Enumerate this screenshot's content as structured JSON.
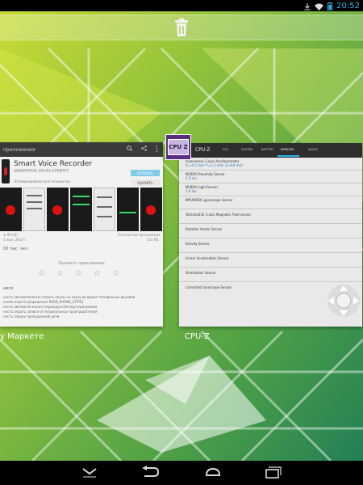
{
  "status_bar": {
    "time": "20:52"
  },
  "recents": {
    "trash_icon": "trash-icon",
    "cards": [
      {
        "caption": "у Маркете",
        "app_bar_title": "приложения",
        "app_title": "Smart Voice Recorder",
        "developer": "SMARTMOB DEVELOPMENT",
        "open_button": "ОТКРЫТЬ",
        "delete_button": "УДАЛИТЬ",
        "optimized": "Оптимизировано для планшетов",
        "meta_left": "★ 89 631",
        "meta_left2": "1 июл. 2014 г.",
        "meta_right": "Бесплатное приложение",
        "meta_right2": "241 КБ",
        "downloads": "00 тыс. чел.",
        "rate_label": "Оценить приложение",
        "description_title": "ного",
        "description_lines": [
          "ность автоматически ставить паузы на паузу во время телефонных вызовов",
          "чение нового разрешения READ_PHONE_STATE)",
          "ность автоматического перехода в беззвучный режим",
          "ность скрыть записи от музыкальных проигрывателей",
          "ность записи пропущенной речи"
        ]
      },
      {
        "caption": "CPU-Z",
        "badge_text": "CPU Z",
        "app_title": "CPU-Z",
        "tabs": [
          "SOC",
          "SYSTEM",
          "BATTERY",
          "SENSORS",
          "ABOUT"
        ],
        "active_tab": "SENSORS",
        "sensors": [
          {
            "name": "Invensense 3-axis Accelerometer",
            "value": "X=-0.2 m/s²  Y=1.1 m/s²  Z=9.6 m/s²"
          },
          {
            "name": "NVIDIA Proximity Sensor",
            "value": "1.0 cm"
          },
          {
            "name": "NVIDIA Light Sensor",
            "value": "1.0 lux"
          },
          {
            "name": "MPU6050C gyroscope Sensor",
            "value": ""
          },
          {
            "name": "Yamaha032 3-axis Magnetic Field sensor",
            "value": ""
          },
          {
            "name": "Rotation Vector Sensor",
            "value": ""
          },
          {
            "name": "Gravity Sensor",
            "value": ""
          },
          {
            "name": "Linear Acceleration Sensor",
            "value": ""
          },
          {
            "name": "Orientation Sensor",
            "value": ""
          },
          {
            "name": "Corrected Gyroscope Sensor",
            "value": ""
          }
        ]
      }
    ]
  },
  "nav_bar": {
    "buttons": [
      "collapse-icon",
      "back-icon",
      "home-icon",
      "recents-icon"
    ]
  },
  "colors": {
    "status_clock": "#2fb6e8",
    "wallpaper_green": "#6fa33a",
    "cpuz_purple": "#5a2d82"
  }
}
